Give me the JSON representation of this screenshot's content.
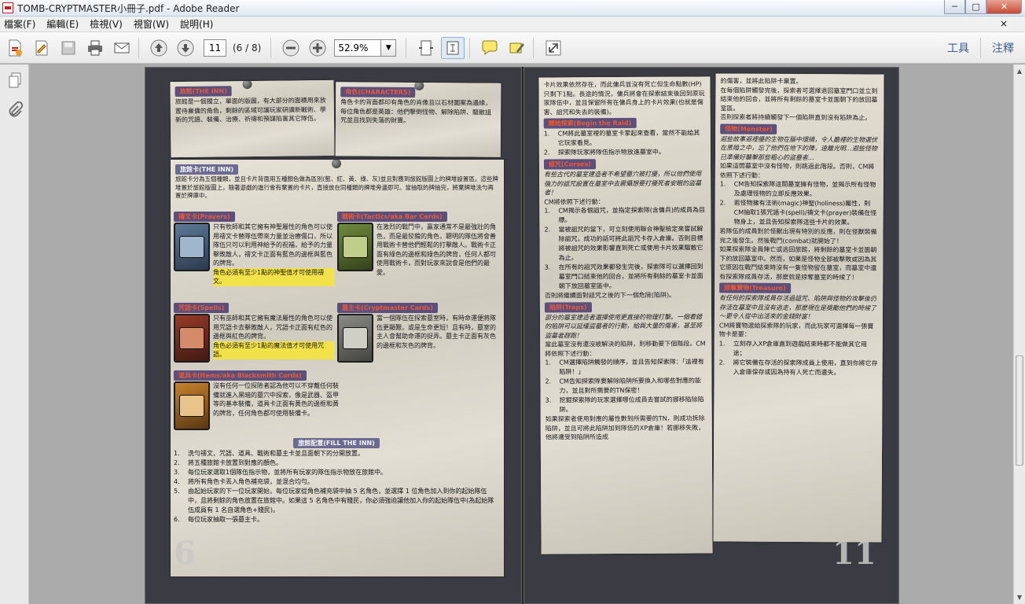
{
  "window": {
    "title": "TOMB-CRYPTMASTER小冊子.pdf - Adobe Reader",
    "controls": {
      "minimize": "─",
      "maximize": "□",
      "close": "✕"
    }
  },
  "menu": {
    "items": [
      "檔案(F)",
      "編輯(E)",
      "檢視(V)",
      "視窗(W)",
      "說明(H)"
    ],
    "close": "×"
  },
  "toolbar": {
    "page_value": "11",
    "page_count": "(6 / 8)",
    "zoom_value": "52.9%",
    "zoom_drop": "▼",
    "tools_label": "工具",
    "comment_label": "注釋"
  },
  "scroll": {
    "up": "▲",
    "down": "▼"
  },
  "left": {
    "inn_title": "旅館(THE INN)",
    "inn_text": "旅館是一個獨立，單面的版圖，有大部分的面積用來放置待雇傭的角色，剩餘的區域可讓玩家研讀新戰術、學新的咒語、裝備、治療、祈禱和預謀陷害其它隊伍。",
    "chars_title": "角色(CHARACTERS)",
    "chars_text": "角色卡的背面都印有角色的肖像且以石材圖案為邊緣，每位角色都是英雄：他們擊倒怪物、解除陷阱、驅散詛咒並且找到失落的財寶。",
    "inncards_title": "旅館卡(THE INN)",
    "inncards_text": "旅館卡分為五個種類，並且卡片背面用五種顏色做為區別(藍、紅、黃、綠、灰)並且對應到旅館版圖上的牌堆設置區。這些牌堆置於旅館版圖上，隨著遊戲的進行會有棄置的卡片，直接放在同種類的牌堆旁邊即可。當抽取的牌抽完，將棄牌堆洗勻再置於牌庫中。",
    "prayers_title": "禱文卡(Prayers)",
    "prayers_text": "只有牧師和其它擁有神聖屬性的角色可以使用禱文卡替隊伍帶來力量並治療傷口，所以隊伍只可以利用神給予的祝福，給予的力量擊敗敵人，禱文卡正面有藍色的邊框與藍色的牌背。",
    "prayers_note": "角色必須有至少1點的神聖值才可使用禱文。",
    "tactics_title": "戰術卡(Tactics/aka Bar Cards)",
    "tactics_text": "在激烈的戰鬥中，贏家通常不是最強壯的角色，而是最狡猾的角色，聰明的隊伍將會善用戰術卡替他們輕鬆的打擊敵人。戰術卡正面有綠色的邊框和綠色的牌背，任何人都可使用戰術卡，而對玩家來說會是他們的最愛。",
    "spells_title": "咒語卡(Spells)",
    "spells_text": "只有巫師和其它擁有魔法屬性的角色可以使用咒語卡去擊敗敵人，咒語卡正面有紅色的邊框與紅色的牌背。",
    "spells_note": "角色必須有至少1點的魔法值才可使用咒語。",
    "crypt_title": "墓主卡(Cryptmaster Cards)",
    "crypt_text": "當一個隊伍在探索墓室時，有時命運便將隊伍更顯艱，或是生命更短！且有時，墓室的主人會幫助命運的捉弄。墓主卡正面有灰色的邊框和灰色的牌背。",
    "items_title": "道具卡(Items/aka Blacksmith Cards)",
    "items_text": "沒有任何一位探險者認為他可以不穿戴任何裝備就進入黑暗的墓穴中探索，像是武器、盔甲等的基本裝備，道具卡正面有黃色的邊框和黃的牌背，任何角色都可使用裝備卡。",
    "setup_title": "旅館配置(FILL THE INN)",
    "setup_items": [
      "洗勻禱文、咒語、道具、戰術和墓主卡並且面朝下的分開放置。",
      "將五種旅館卡放置到對應的顏色。",
      "每位玩家選取1個隊伍指示物，並將所有玩家的隊伍指示物放在旅館中。",
      "將所有角色卡丟入角色補充袋，並混合均勻。",
      "由起始玩家的下一位玩家開始，每位玩家從角色補充袋中抽 5 名角色，並選擇 1 位角色加入到你的起始隊伍中，且將剩餘的角色放置在旅館中。如果這 5 名角色中有賤民，你必須強迫讓他加入你的起始隊伍中(為起始隊伍成員有 1 名自選角色+賤民)。",
      "每位玩家抽取一張墓主卡。"
    ],
    "page_number": "6"
  },
  "right": {
    "col1_intro": "卡片效果依然存在，而此傭兵並沒有死亡但生命點數(HP)只剩下1點。長途的情況，傭兵將會在探索結束後回到原玩家隊伍中，並且保留所有在傭兵身上的卡片效果(也就是傷害、詛咒和失去的裝備)。",
    "raid_title": "開始探索(Begin the Raid)",
    "raid_items": [
      "CM將此墓室裡的墓室卡掌起來查看，當然不能給其它玩家看見。",
      "探索隊玩家將隊伍指示物放進墓室中。"
    ],
    "curses_title": "詛咒(Curses)",
    "curses_flavor": "有些古代的墓室建造者不希望墓穴被打擾，所以他們使用強力的詛咒設置在墓室中去震懾想要打擾死者安眠的盜墓者！",
    "curses_steps_intro": "CM將依照下述行動：",
    "curses_items": [
      "CM揭示各個詛咒，並指定探索隊(含傭兵)的成員為目標。",
      "當被詛咒的當下，可立刻使用聯合神聖檢定來嘗試解除詛咒，成功的話可將此詛咒卡存入倉庫。否則目標將被詛咒的效果影響直到死亡或使用卡片效果驅散它為止。",
      "在所有的詛咒效果都發生完後，探索隊可以選擇回到墓室門口結束他的回合，並將所有剩餘的墓室卡並面朝下放回墓室區中。"
    ],
    "curses_end": "否則將繼續面對詛咒之後的下一個危險(陷阱)。",
    "traps_title": "陷阱(Traps)",
    "traps_flavor": "部分的墓室建造者選擇使用更直接的物理打擊。一個看錯的陷阱可以延緩盜墓者的行動，給與大量的傷害，甚至將盜墓者趕跑！",
    "traps_text": "當此墓室沒有還沒被解決的陷阱，則移動要下個階段。CM將依照下述行動：",
    "traps_items": [
      "CM選擇陷阱觸發的順序，並且告知探索隊：「這裡有陷阱！」",
      "CM告知探索隊要解除陷阱所要換入和哪些對應的能力，並且對所需要的TN保密！",
      "挖掘探索隊的玩家選擇哪位成員去嘗試的挪移陷除陷阱。"
    ],
    "traps_end": "如果探索者使用對應的屬性數到所需要的TN，則成功拆除陷阱，並且可將此陷阱加到隊伍的XP倉庫！若挪移失敗，他將遭受到陷阱所造成",
    "col2_intro": "的傷害，並將此陷阱卡棄置。",
    "col2_text1": "在每個陷阱觸發完後，探索者可選擇退回墓室門口並立刻結束他的回合，並將所有剩餘的墓室卡並面朝下的放回墓室區。",
    "col2_text2": "否則探索者將持續觸發下一個陷阱直到沒有陷阱為止。",
    "monster_title": "怪物(Monster)",
    "monster_flavor": "遐些故事遐裡擾的生物在腦中環繞，令人膽裡的生物選伏在黑暗之中，忘了他們在地下的陣，遠離光明…遐些怪物已準備好襲擊那些粗心的盜墓者…",
    "monster_text": "如果這間墓室中沒有怪物，則跳過此階段。否則，CM將依照下述行動：",
    "monster_items": [
      "CM告知探索隊這間墓室擁有怪物，並揭示所有怪物及處理怪物的立即反應效果。",
      "若怪物擁有法術(magic)神聖(holiness)屬性，則CM抽取1張咒語卡(spell)/禱文卡(prayer)裝備在怪物身上，並且告知探索隊這些卡片的效果。"
    ],
    "monster_text2": "若隊伍的成員對於怪獸出現有特別的反應，則在怪獸裝備完之後發生。然後戰鬥(combat)就開始了！",
    "monster_text3": "如果探索隊全員陣亡或逃回旅館，將剩餘的墓室卡並面朝下的放回墓室中。然而，如果是怪物全部被擊敗或因為其它原因在戰鬥結束時沒有一隻怪物留在墓室，而墓室中還有探索隊成員存活，那麼就是掠奪墓室的時候了！",
    "treasure_title": "掠奪寶物(Treasure)",
    "treasure_flavor": "有任何的探索隊成員存活過詛咒、陷阱與怪物的攻擊後仍存活在墓室中且沒有逃走，那麼現在是獎勵他們的時候了～更令人從中出活來的金錢財富！",
    "treasure_text": "CM將寶物遞給探索隊的玩家，而此玩家可選擇每一張寶物卡是要：",
    "treasure_items": [
      "立刻存入XP倉庫直到遊戲結束時都不能做其它用途；",
      "將它裝備在存活的探索隊成員上使用，直到你將它存入倉庫保存或因為持有人死亡而遺失。"
    ],
    "page_number": "11"
  }
}
